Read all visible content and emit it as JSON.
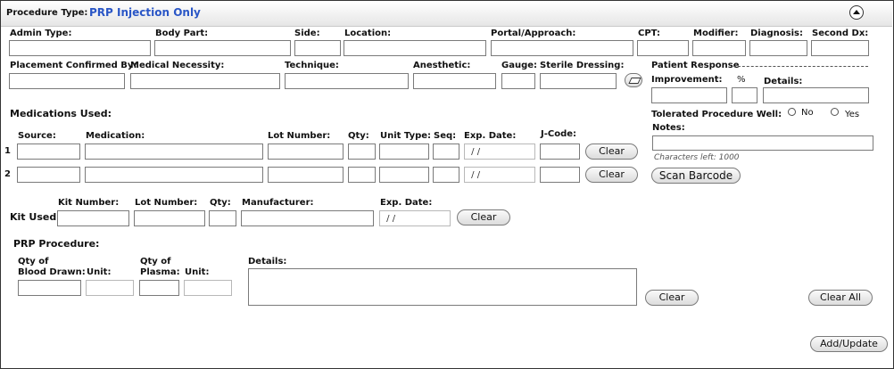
{
  "header": {
    "label": "Procedure Type:",
    "value": "PRP Injection Only",
    "collapse_icon": "chevron-up-circle-icon"
  },
  "row1": {
    "admin_type": "Admin Type:",
    "body_part": "Body Part:",
    "side": "Side:",
    "location": "Location:",
    "portal": "Portal/Approach:",
    "cpt": "CPT:",
    "modifier": "Modifier:",
    "diagnosis": "Diagnosis:",
    "second_dx": "Second Dx:"
  },
  "row2": {
    "placement": "Placement Confirmed By:",
    "necessity": "Medical Necessity:",
    "technique": "Technique:",
    "anesthetic": "Anesthetic:",
    "gauge": "Gauge:",
    "dressing": "Sterile Dressing:",
    "eraser_icon": "eraser-icon"
  },
  "response": {
    "title": "Patient Response",
    "improvement": "Improvement:",
    "percent": "%",
    "details": "Details:",
    "tolerated": "Tolerated Procedure Well:",
    "no": "No",
    "yes": "Yes",
    "notes": "Notes:",
    "chars_left": "Characters left: 1000",
    "scan_barcode": "Scan Barcode"
  },
  "medications": {
    "title": "Medications Used:",
    "columns": {
      "source": "Source:",
      "medication": "Medication:",
      "lot": "Lot Number:",
      "qty": "Qty:",
      "unit_type": "Unit Type:",
      "seq": "Seq:",
      "exp": "Exp. Date:",
      "jcode": "J-Code:"
    },
    "rows": [
      {
        "num": "1",
        "exp": " / /",
        "clear": "Clear"
      },
      {
        "num": "2",
        "exp": " / /",
        "clear": "Clear"
      }
    ]
  },
  "kit": {
    "label": "Kit Used:",
    "kit_number": "Kit Number:",
    "lot": "Lot Number:",
    "qty": "Qty:",
    "manufacturer": "Manufacturer:",
    "exp": "Exp. Date:",
    "exp_value": " / /",
    "clear": "Clear"
  },
  "prp": {
    "title": "PRP Procedure:",
    "qty_blood_1": "Qty of",
    "qty_blood_2": "Blood Drawn:",
    "unit1": "Unit:",
    "qty_plasma_1": "Qty of",
    "qty_plasma_2": "Plasma:",
    "unit2": "Unit:",
    "details": "Details:",
    "clear": "Clear"
  },
  "actions": {
    "clear_all": "Clear All",
    "add_update": "Add/Update"
  }
}
